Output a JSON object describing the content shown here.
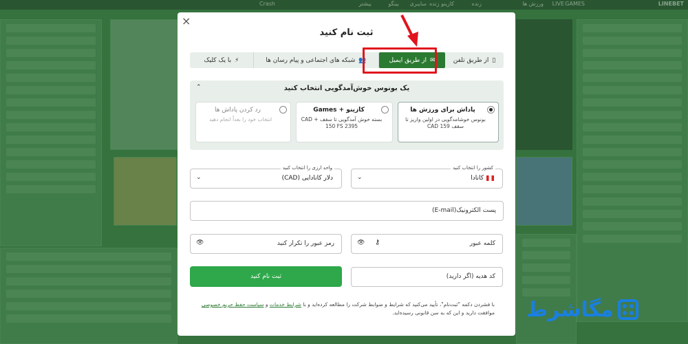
{
  "background": {
    "top_links": [
      "ورزش ها",
      "LIVE",
      "GAMES",
      "زنده",
      "کازینو زنده",
      "سایبری",
      "بینگو",
      "بیشتر",
      "Crash"
    ],
    "logo": "LINEBET"
  },
  "modal": {
    "title": "ثبت نام کنید",
    "close_label": "×",
    "tabs": [
      {
        "label": "از طریق تلفن",
        "icon": "phone-icon",
        "glyph": "▯"
      },
      {
        "label": "از طریق ایمیل",
        "icon": "envelope-icon",
        "glyph": "✉"
      },
      {
        "label": "شبکه های اجتماعی و پیام رسان ها",
        "icon": "people-icon",
        "glyph": "👥"
      },
      {
        "label": "با یک کلیک",
        "icon": "lightning-icon",
        "glyph": "⚡"
      }
    ],
    "bonus": {
      "title": "یک بونوس خوش‌آمدگویی انتخاب کنید",
      "chevron": "⌃",
      "options": [
        {
          "title": "پاداش برای ورزش ها",
          "desc": "بونوس خوشامدگویی در اولین واریز تا سقف 159 CAD",
          "selected": true
        },
        {
          "title": "کازینو + Games",
          "desc": "بسته خوش آمدگویی تا سقف CAD + 150 FS 2395",
          "selected": false
        },
        {
          "title": "رد کردن پاداش ها",
          "desc": "انتخاب خود را بعداً انجام دهید",
          "selected": false
        }
      ]
    },
    "country": {
      "label": "کشور را انتخاب کنید",
      "value": "کانادا"
    },
    "currency": {
      "label": "واحد ارزی را انتخاب کنید",
      "value": "دلار کانادایی (CAD)"
    },
    "email_placeholder": "پست الکترونیک(E-mail)",
    "password_placeholder": "کلمه عبور",
    "password_repeat_placeholder": "رمز عبور را تکرار کنید",
    "promo_placeholder": "کد هدیه (اگر دارید)",
    "submit_label": "ثبت نام کنید",
    "terms": {
      "prefix": "با فشردن دکمه \"ثبت‌نام\"، تأیید می‌کنید که شرایط و ضوابط شرکت را مطالعه کرده‌اید و با ",
      "link1": "شرایط خدمات",
      "middle": " و ",
      "link2": "سیاست حفظ حریم خصوصی",
      "suffix": " موافقت دارید و این که به سن قانونی رسیده‌اید."
    }
  },
  "watermark": {
    "text": "مگاشرط"
  },
  "colors": {
    "accent_green": "#2b7a32",
    "button_green": "#2ea84b",
    "highlight_red": "#e0141d",
    "watermark_blue": "#1a7fe0"
  }
}
